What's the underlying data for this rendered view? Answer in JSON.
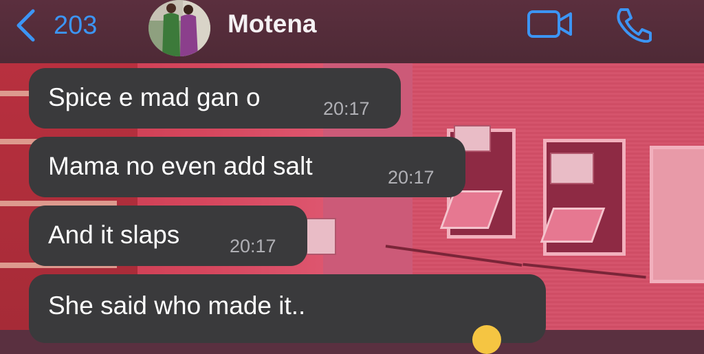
{
  "header": {
    "back_count": "203",
    "contact_name": "Motena",
    "back_icon": "chevron-left-icon",
    "video_icon": "video-camera-icon",
    "call_icon": "phone-icon",
    "accent_color": "#3c95f5"
  },
  "messages": [
    {
      "text": "Spice e mad gan o",
      "time": "20:17"
    },
    {
      "text": "Mama no even add salt",
      "time": "20:17"
    },
    {
      "text": "And it slaps",
      "time": "20:17"
    },
    {
      "text": "She said who made it..",
      "time": ""
    }
  ]
}
